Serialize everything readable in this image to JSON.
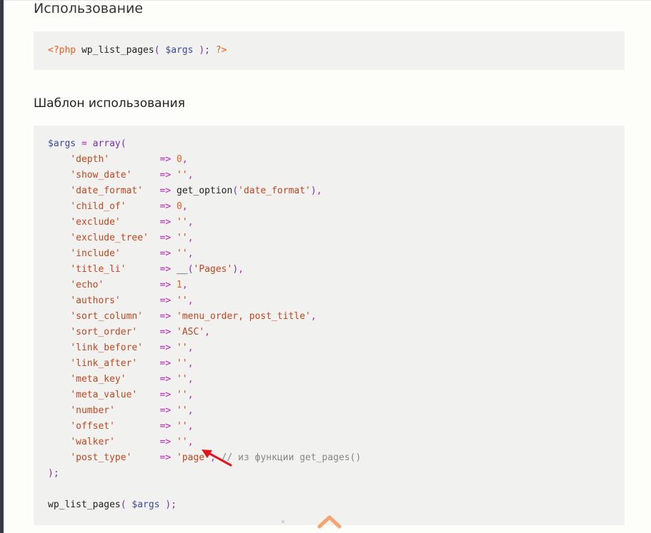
{
  "headings": {
    "usage": "Использование",
    "template": "Шаблон использования"
  },
  "usage_code": {
    "open_tag": "<?php",
    "fn": "wp_list_pages",
    "paren_open": "(",
    "var": "$args",
    "paren_close": ");",
    "close_tag": "?>"
  },
  "template_code": {
    "head": {
      "var": "$args",
      "eq": "=",
      "fn": "array",
      "paren": "("
    },
    "lines": [
      {
        "key": "'depth'",
        "pad": "        ",
        "value": "0",
        "kind": "num"
      },
      {
        "key": "'show_date'",
        "pad": "    ",
        "value": "''",
        "kind": "str"
      },
      {
        "key": "'date_format'",
        "pad": "  ",
        "value": "",
        "kind": "call",
        "call_fn": "get_option",
        "call_arg": "'date_format'"
      },
      {
        "key": "'child_of'",
        "pad": "     ",
        "value": "0",
        "kind": "num"
      },
      {
        "key": "'exclude'",
        "pad": "      ",
        "value": "''",
        "kind": "str"
      },
      {
        "key": "'exclude_tree'",
        "pad": " ",
        "value": "''",
        "kind": "str"
      },
      {
        "key": "'include'",
        "pad": "      ",
        "value": "''",
        "kind": "str"
      },
      {
        "key": "'title_li'",
        "pad": "     ",
        "value": "",
        "kind": "call",
        "call_fn": "__",
        "call_arg": "'Pages'"
      },
      {
        "key": "'echo'",
        "pad": "         ",
        "value": "1",
        "kind": "num"
      },
      {
        "key": "'authors'",
        "pad": "      ",
        "value": "''",
        "kind": "str"
      },
      {
        "key": "'sort_column'",
        "pad": "  ",
        "value": "'menu_order, post_title'",
        "kind": "str"
      },
      {
        "key": "'sort_order'",
        "pad": "   ",
        "value": "'ASC'",
        "kind": "str"
      },
      {
        "key": "'link_before'",
        "pad": "  ",
        "value": "''",
        "kind": "str"
      },
      {
        "key": "'link_after'",
        "pad": "   ",
        "value": "''",
        "kind": "str"
      },
      {
        "key": "'meta_key'",
        "pad": "     ",
        "value": "''",
        "kind": "str"
      },
      {
        "key": "'meta_value'",
        "pad": "   ",
        "value": "''",
        "kind": "str"
      },
      {
        "key": "'number'",
        "pad": "       ",
        "value": "''",
        "kind": "str"
      },
      {
        "key": "'offset'",
        "pad": "       ",
        "value": "''",
        "kind": "str"
      },
      {
        "key": "'walker'",
        "pad": "       ",
        "value": "''",
        "kind": "str"
      },
      {
        "key": "'post_type'",
        "pad": "    ",
        "value": "'page'",
        "kind": "str",
        "comment": "// из функции get_pages()"
      }
    ],
    "arrow_op": "=>",
    "comma": ",",
    "tail": ");",
    "call_line": {
      "fn": "wp_list_pages",
      "paren_open": "(",
      "var": "$args",
      "paren_close": ");"
    }
  },
  "colors": {
    "background": "#fdfdfa",
    "code_background": "#f1f1f0",
    "annotation_arrow": "#e3141b",
    "scroll_top_chevron": "#f3a56f"
  },
  "icons": {
    "annotation": "red-arrow-icon",
    "scroll_top": "chevron-up-icon"
  }
}
